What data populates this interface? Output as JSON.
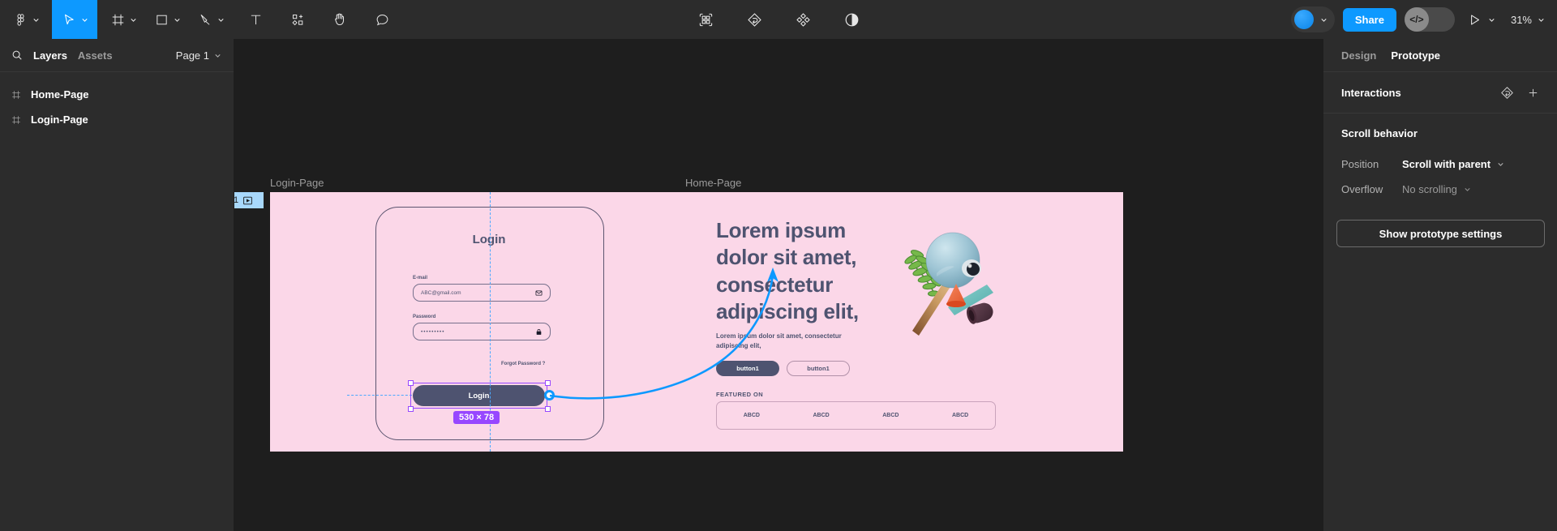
{
  "toolbar": {
    "left_tools": [
      {
        "name": "figma-menu-icon",
        "caret": true,
        "active": false
      },
      {
        "name": "move-tool-icon",
        "caret": true,
        "active": true
      },
      {
        "name": "frame-tool-icon",
        "caret": true,
        "active": false
      },
      {
        "name": "shape-tool-icon",
        "caret": true,
        "active": false
      },
      {
        "name": "pen-tool-icon",
        "caret": true,
        "active": false
      },
      {
        "name": "text-tool-icon",
        "caret": false,
        "active": false
      },
      {
        "name": "actions-tool-icon",
        "caret": false,
        "active": false
      },
      {
        "name": "hand-tool-icon",
        "caret": false,
        "active": false
      },
      {
        "name": "comment-tool-icon",
        "caret": false,
        "active": false
      }
    ],
    "center_tools": [
      {
        "name": "dev-mode-icon"
      },
      {
        "name": "prototype-icon"
      },
      {
        "name": "components-icon"
      },
      {
        "name": "contrast-icon"
      }
    ],
    "share_label": "Share",
    "code_label": "</>",
    "zoom_label": "31%"
  },
  "left_panel": {
    "tabs": [
      {
        "label": "Layers",
        "active": true
      },
      {
        "label": "Assets",
        "active": false
      }
    ],
    "page_selector": "Page 1",
    "layers": [
      {
        "label": "Home-Page",
        "icon": "frame-icon"
      },
      {
        "label": "Login-Page",
        "icon": "frame-icon"
      }
    ]
  },
  "right_panel": {
    "tabs": [
      {
        "label": "Design",
        "active": false
      },
      {
        "label": "Prototype",
        "active": true
      }
    ],
    "interactions_label": "Interactions",
    "scroll_behavior_heading": "Scroll behavior",
    "rows": [
      {
        "key": "Position",
        "value": "Scroll with parent",
        "muted": false
      },
      {
        "key": "Overflow",
        "value": "No scrolling",
        "muted": true
      }
    ],
    "prototype_settings_button": "Show prototype settings"
  },
  "canvas": {
    "flow_badge": {
      "number": "1",
      "icon": "flow-start-icon"
    },
    "back_chip_icon": "back-arrow-icon",
    "selection": {
      "size_badge": "530 × 78",
      "accent_color": "#9747ff",
      "connector_color": "#0d99ff"
    },
    "login_frame": {
      "label": "Login-Page",
      "title": "Login",
      "email_label": "E-mail",
      "email_value": "ABC@gmail.com",
      "email_icon": "envelope-icon",
      "password_label": "Password",
      "password_value": "•••••••••",
      "password_icon": "lock-icon",
      "forgot_label": "Forgot Password ?",
      "submit_label": "Login",
      "background_color": "#fbd7e8",
      "text_color": "#4e5370"
    },
    "home_frame": {
      "label": "Home-Page",
      "hero_title": "Lorem ipsum dolor sit amet, consectetur adipiscing elit,",
      "hero_sub": "Lorem ipsum dolor sit amet, consectetur adipiscing elit,",
      "button_primary": "button1",
      "button_outline": "button1",
      "featured_label": "FEATURED ON",
      "featured_items": [
        "ABCD",
        "ABCD",
        "ABCD",
        "ABCD"
      ],
      "illustration_name": "abstract-3d-illustration",
      "background_color": "#fbd7e8",
      "text_color": "#4e5370"
    }
  }
}
